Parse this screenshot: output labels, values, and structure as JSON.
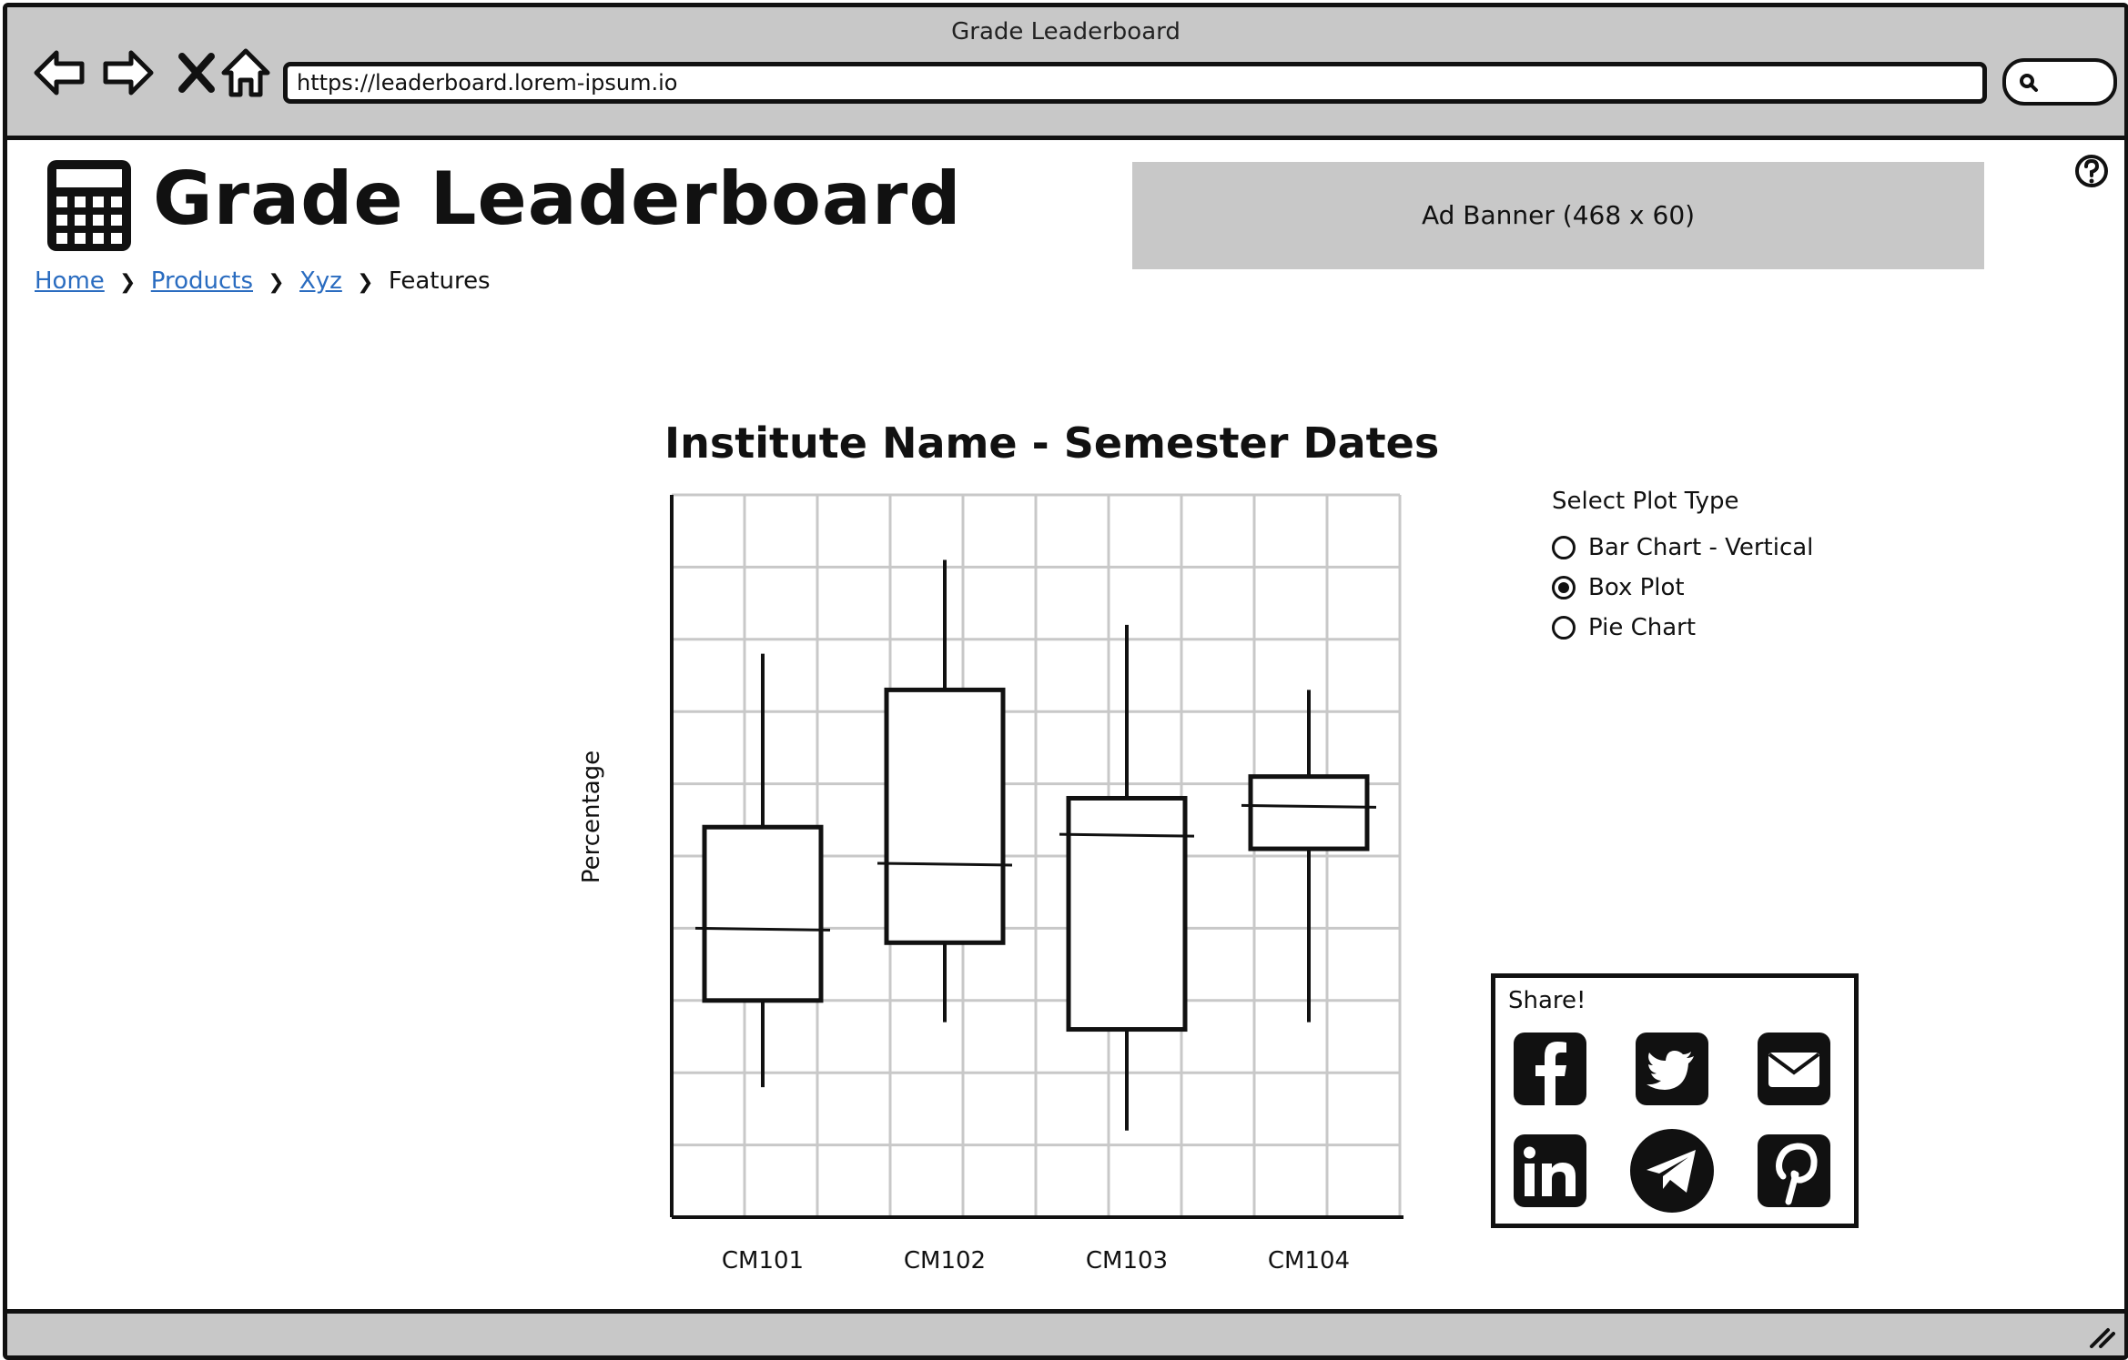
{
  "browser": {
    "window_title": "Grade Leaderboard",
    "url": "https://leaderboard.lorem-ipsum.io"
  },
  "header": {
    "app_title": "Grade Leaderboard",
    "ad_banner": "Ad Banner (468 x 60)"
  },
  "breadcrumb": {
    "items": [
      "Home",
      "Products",
      "Xyz",
      "Features"
    ]
  },
  "plot_type": {
    "label": "Select Plot Type",
    "options": [
      "Bar Chart - Vertical",
      "Box Plot",
      "Pie Chart"
    ],
    "selected": "Box Plot"
  },
  "share": {
    "label": "Share!",
    "icons": [
      "facebook-icon",
      "twitter-icon",
      "email-icon",
      "linkedin-icon",
      "telegram-icon",
      "pinterest-icon"
    ]
  },
  "chart_data": {
    "type": "box",
    "title": "Institute Name - Semester Dates",
    "xlabel": "",
    "ylabel": "Percentage",
    "categories": [
      "CM101",
      "CM102",
      "CM103",
      "CM104"
    ],
    "ylim": [
      0,
      100
    ],
    "grid": true,
    "boxes": [
      {
        "category": "CM101",
        "min": 18,
        "q1": 30,
        "median": 40,
        "q3": 54,
        "max": 78
      },
      {
        "category": "CM102",
        "min": 27,
        "q1": 38,
        "median": 49,
        "q3": 73,
        "max": 91
      },
      {
        "category": "CM103",
        "min": 12,
        "q1": 26,
        "median": 53,
        "q3": 58,
        "max": 82
      },
      {
        "category": "CM104",
        "min": 27,
        "q1": 51,
        "median": 57,
        "q3": 61,
        "max": 73
      }
    ]
  }
}
